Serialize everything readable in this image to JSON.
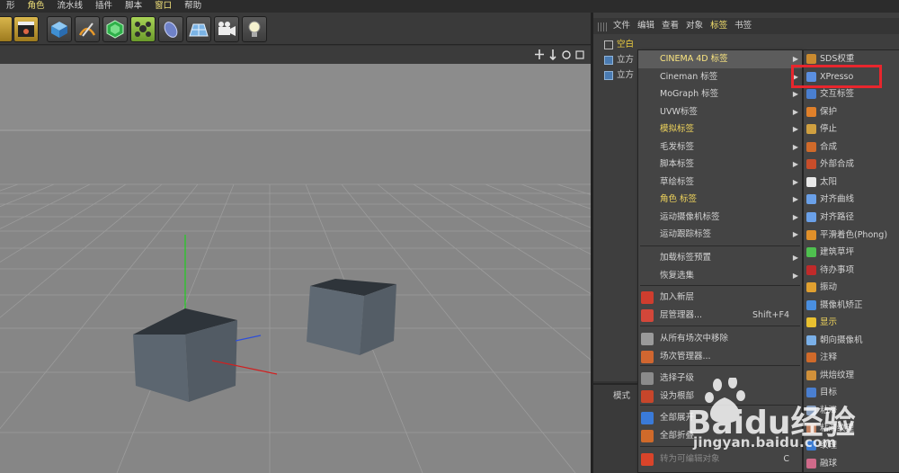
{
  "menubar": {
    "items": [
      "形",
      "角色",
      "流水线",
      "插件",
      "脚本",
      "窗口",
      "帮助"
    ],
    "highlighted": [
      "角色",
      "窗口"
    ]
  },
  "toolbar": {
    "icons": [
      "clapper-icon",
      "render-settings-icon",
      "cube-icon",
      "pen-icon",
      "subdivision-icon",
      "mograph-cloner-icon",
      "deformer-icon",
      "floor-grid-icon",
      "camera-icon",
      "light-bulb-icon"
    ]
  },
  "object_manager": {
    "menus": [
      "文件",
      "编辑",
      "查看",
      "对象",
      "标签",
      "书签"
    ],
    "active_menu": "标签",
    "tree": [
      {
        "label": "空白",
        "icon": "null-object-icon"
      },
      {
        "label": "立方",
        "icon": "cube-icon"
      },
      {
        "label": "立方",
        "icon": "cube-icon"
      }
    ]
  },
  "attributes": {
    "tab_label": "模式"
  },
  "context_menu": {
    "items": [
      {
        "label": "CINEMA 4D 标签",
        "submenu": true,
        "active": true
      },
      {
        "label": "Cineman 标签",
        "submenu": true
      },
      {
        "label": "MoGraph 标签",
        "submenu": true
      },
      {
        "label": "UVW标签",
        "submenu": true
      },
      {
        "label": "模拟标签",
        "submenu": true,
        "yellow": true
      },
      {
        "label": "毛发标签",
        "submenu": true
      },
      {
        "label": "脚本标签",
        "submenu": true
      },
      {
        "label": "草绘标签",
        "submenu": true
      },
      {
        "label": "角色 标签",
        "submenu": true,
        "yellow": true
      },
      {
        "label": "运动摄像机标签",
        "submenu": true
      },
      {
        "label": "运动跟踪标签",
        "submenu": true
      },
      {
        "label": "加载标签预置",
        "submenu": true
      },
      {
        "label": "恢复选集",
        "submenu": true
      },
      {
        "label": "加入新层",
        "icon": "add-layer-icon"
      },
      {
        "label": "层管理器...",
        "shortcut": "Shift+F4",
        "icon": "layer-manager-icon"
      },
      {
        "label": "从所有场次中移除",
        "icon": "remove-from-takes-icon"
      },
      {
        "label": "场次管理器...",
        "icon": "take-manager-icon"
      },
      {
        "label": "选择子级",
        "icon": "select-children-icon"
      },
      {
        "label": "设为根部",
        "icon": "set-as-root-icon"
      },
      {
        "label": "全部展开",
        "icon": "expand-all-icon"
      },
      {
        "label": "全部折叠",
        "icon": "collapse-all-icon"
      },
      {
        "label": "转为可编辑对象",
        "shortcut": "C",
        "icon": "make-editable-icon",
        "dim": true
      }
    ]
  },
  "submenu": {
    "items": [
      {
        "label": "SDS权重",
        "icon": "sds-weight-icon"
      },
      {
        "label": "XPresso",
        "icon": "xpresso-icon",
        "boxed": true
      },
      {
        "label": "交互标签",
        "icon": "interaction-tag-icon"
      },
      {
        "label": "保护",
        "icon": "protection-icon"
      },
      {
        "label": "停止",
        "icon": "stop-icon"
      },
      {
        "label": "合成",
        "icon": "compositing-icon"
      },
      {
        "label": "外部合成",
        "icon": "external-compositing-icon"
      },
      {
        "label": "太阳",
        "icon": "sun-icon"
      },
      {
        "label": "对齐曲线",
        "icon": "align-to-spline-icon"
      },
      {
        "label": "对齐路径",
        "icon": "align-to-path-icon"
      },
      {
        "label": "平滑着色(Phong)",
        "icon": "phong-icon"
      },
      {
        "label": "建筑草坪",
        "icon": "architectural-grass-icon"
      },
      {
        "label": "待办事项",
        "icon": "todo-icon"
      },
      {
        "label": "振动",
        "icon": "vibrate-icon"
      },
      {
        "label": "摄像机矫正",
        "icon": "camera-calibration-icon"
      },
      {
        "label": "显示",
        "icon": "display-icon",
        "yellow": true
      },
      {
        "label": "朝向摄像机",
        "icon": "look-at-camera-icon"
      },
      {
        "label": "注释",
        "icon": "annotation-icon"
      },
      {
        "label": "烘焙纹理",
        "icon": "bake-texture-icon"
      },
      {
        "label": "目标",
        "icon": "target-icon"
      },
      {
        "label": "粘滞",
        "icon": "stick-icon"
      },
      {
        "label": "粘滞纹理",
        "icon": "stick-texture-icon"
      },
      {
        "label": "纹理",
        "icon": "texture-icon"
      },
      {
        "label": "融球",
        "icon": "metaball-icon"
      }
    ]
  },
  "viewport": {
    "objects": [
      "cube-left",
      "cube-right"
    ],
    "axes_colors": {
      "y": "#1fd01f",
      "x": "#d02020",
      "z": "#2f4fd8"
    }
  },
  "watermark": {
    "logo": "Baidu经验",
    "url": "jingyan.baidu.com"
  },
  "colors": {
    "highlight_box": "#e8262d",
    "menu_yellow": "#f2d65c",
    "panel_bg": "#444444"
  }
}
